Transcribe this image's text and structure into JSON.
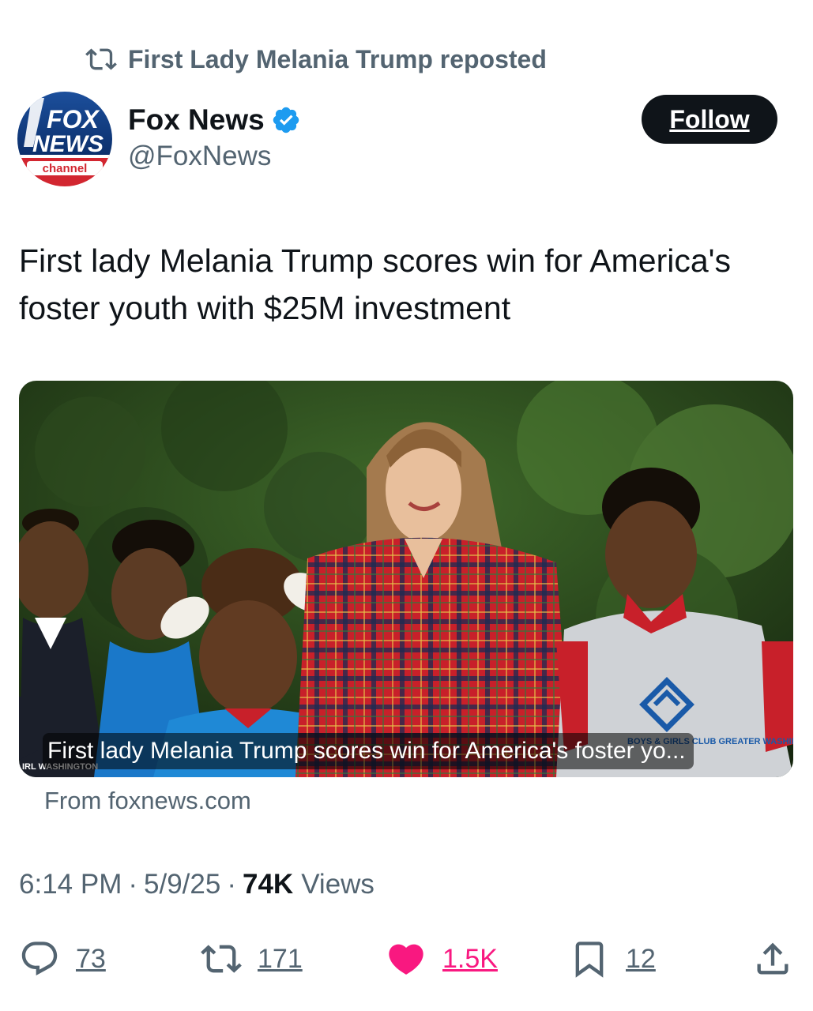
{
  "repost": {
    "label": "First Lady Melania Trump reposted",
    "icon": "repost-icon"
  },
  "author": {
    "name": "Fox News",
    "handle": "@FoxNews",
    "verified": true,
    "avatar_text": {
      "line1": "FOX",
      "line2": "NEWS",
      "line3": "channel"
    }
  },
  "follow_button": {
    "label": "Follow"
  },
  "tweet": {
    "text": "First lady Melania Trump scores win for America's foster youth with $25M investment"
  },
  "card": {
    "caption": "First lady Melania Trump scores win for America's foster yo...",
    "source": "From foxnews.com",
    "photo_signage": {
      "left": "IRL WASHINGTON",
      "right": "BOYS & GIRLS CLUB GREATER WASHINGTON"
    }
  },
  "meta": {
    "time": "6:14 PM",
    "date": "5/9/25",
    "views_count": "74K",
    "views_label": "Views"
  },
  "actions": {
    "replies": "73",
    "reposts": "171",
    "likes": "1.5K",
    "bookmarks": "12"
  },
  "colors": {
    "text_primary": "#0f1419",
    "text_secondary": "#536471",
    "like_pink": "#f91880",
    "verified_blue": "#1d9bf0",
    "follow_bg": "#0f1419"
  }
}
